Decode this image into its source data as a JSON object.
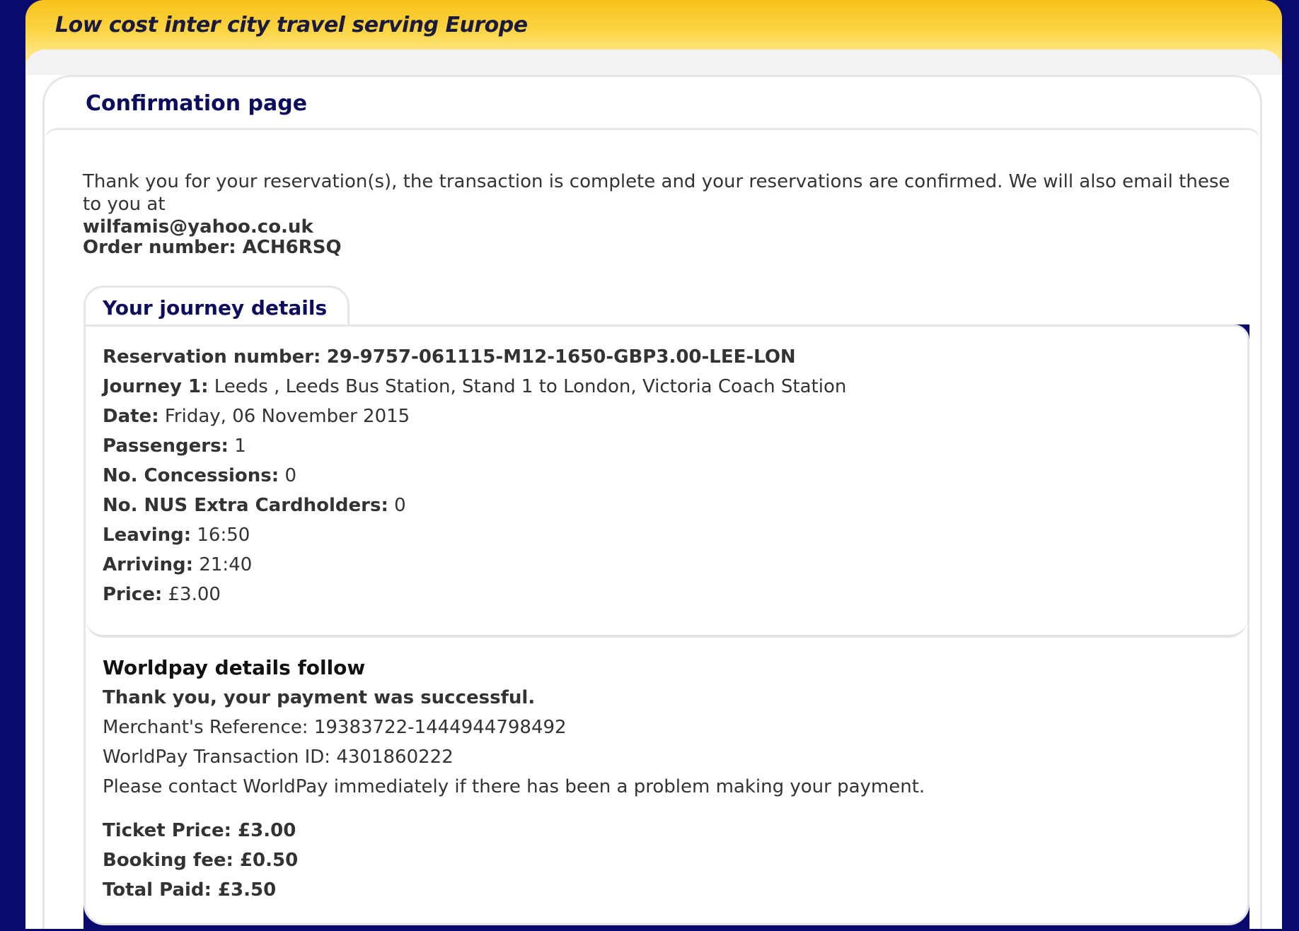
{
  "header": {
    "tagline": "Low cost inter city travel serving Europe"
  },
  "page": {
    "title": "Confirmation page",
    "intro": "Thank you for your reservation(s), the transaction is complete and your reservations are confirmed. We will also email these to you at",
    "email": "wilfamis@yahoo.co.uk",
    "order_label": "Order number:",
    "order_value": "ACH6RSQ"
  },
  "journey": {
    "tab_label": "Your journey details",
    "rows": [
      {
        "label": "Reservation number:",
        "value": "29-9757-061115-M12-1650-GBP3.00-LEE-LON",
        "value_bold": true
      },
      {
        "label": "Journey 1:",
        "value": "Leeds , Leeds Bus Station, Stand 1 to London, Victoria Coach Station"
      },
      {
        "label": "Date:",
        "value": "Friday, 06 November 2015"
      },
      {
        "label": "Passengers:",
        "value": "1"
      },
      {
        "label": "No. Concessions:",
        "value": "0"
      },
      {
        "label": "No. NUS Extra Cardholders:",
        "value": "0"
      },
      {
        "label": "Leaving:",
        "value": "16:50"
      },
      {
        "label": "Arriving:",
        "value": "21:40"
      },
      {
        "label": "Price:",
        "value": "£3.00"
      }
    ]
  },
  "worldpay": {
    "title": "Worldpay details follow",
    "success": "Thank you, your payment was successful.",
    "merchant_ref": "Merchant's Reference: 19383722-1444944798492",
    "transaction_id": "WorldPay Transaction ID: 4301860222",
    "contact": "Please contact WorldPay immediately if there has been a problem making your payment.",
    "ticket_price": "Ticket Price: £3.00",
    "booking_fee": "Booking fee: £0.50",
    "total_paid": "Total Paid: £3.50"
  }
}
